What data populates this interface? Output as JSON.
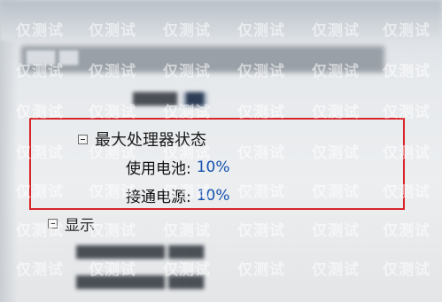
{
  "window": {
    "title_blurred": "███ ██"
  },
  "tree": {
    "blurred_row_text": "█████",
    "blurred_row_chip": "██",
    "section": {
      "label": "最大处理器状态",
      "expander_icon": "minus-box-icon",
      "items": [
        {
          "label": "使用电池:",
          "value": "10%"
        },
        {
          "label": "接通电源:",
          "value": "10%"
        }
      ]
    },
    "display_section": {
      "label": "显示",
      "expander_icon": "minus-box-icon"
    },
    "blurred_items": [
      "██████████ ████",
      "██████████ ████"
    ]
  },
  "highlight_color": "#d8252a",
  "value_color": "#1652b0",
  "watermark": "仅测试"
}
